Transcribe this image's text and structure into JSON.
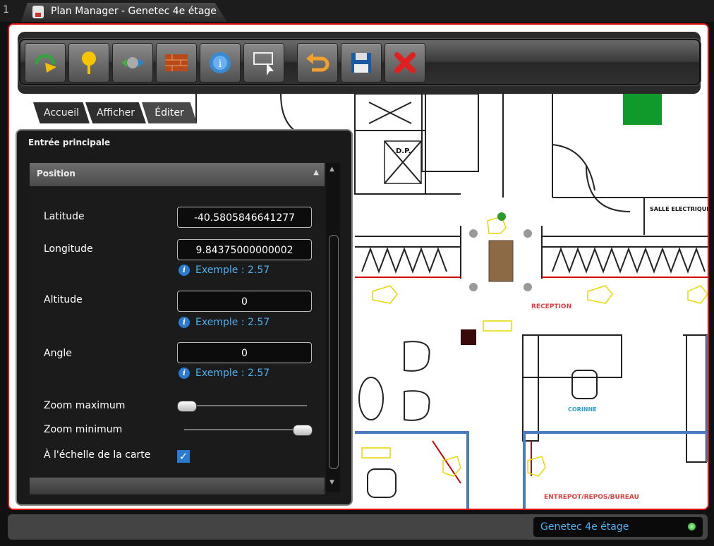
{
  "tab_bar": {
    "index": "1",
    "title": "Plan Manager - Genetec 4e étage"
  },
  "toolbar": {
    "buttons": [
      {
        "name": "refresh-icon"
      },
      {
        "name": "pin-icon"
      },
      {
        "name": "camera-icon"
      },
      {
        "name": "wall-icon"
      },
      {
        "name": "info-signal-icon"
      },
      {
        "name": "select-region-icon"
      },
      {
        "name": "undo-icon"
      },
      {
        "name": "save-icon"
      },
      {
        "name": "close-icon"
      }
    ]
  },
  "ribbon_tabs": [
    "Accueil",
    "Afficher",
    "Éditer"
  ],
  "panel": {
    "title": "Entrée principale",
    "section": "Position",
    "latitude_label": "Latitude",
    "latitude_value": "-40.5805846641277",
    "longitude_label": "Longitude",
    "longitude_value": "9.84375000000002",
    "altitude_label": "Altitude",
    "altitude_value": "0",
    "angle_label": "Angle",
    "angle_value": "0",
    "hint_text": "Exemple : 2.57",
    "zoom_max_label": "Zoom maximum",
    "zoom_max_level": 0,
    "zoom_min_label": "Zoom minimum",
    "zoom_min_level": 1,
    "scale_label": "À l'échelle de la carte",
    "scale_checked": true
  },
  "floorplan": {
    "labels": {
      "dp": "D.P.",
      "salle": "SALLE ELECTRIQUE",
      "reception": "RECEPTION",
      "corinne": "CORINNE",
      "entrepot": "ENTREPOT/REPOS/BUREAU"
    }
  },
  "status": {
    "label": "Genetec 4e étage"
  }
}
